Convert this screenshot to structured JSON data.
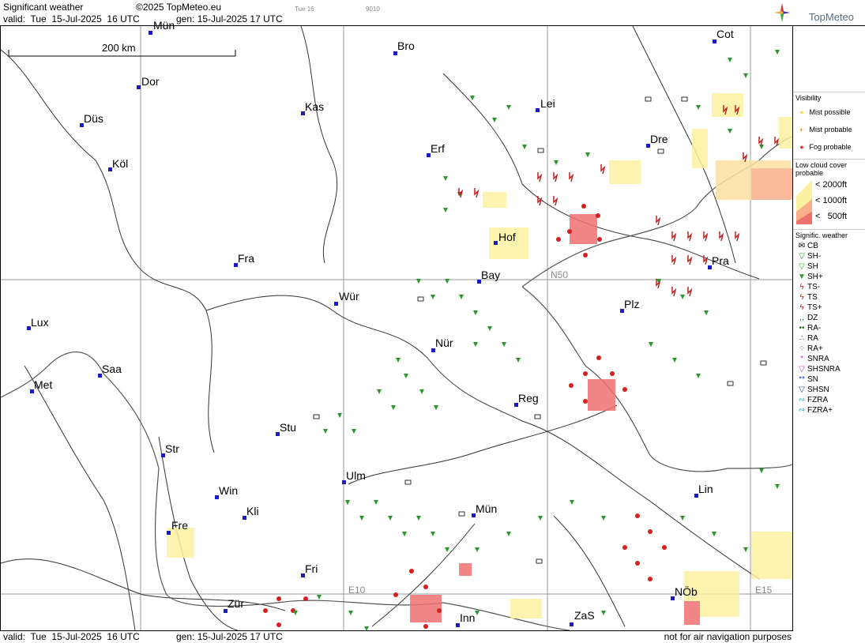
{
  "header": {
    "title": "Significant weather",
    "copyright": "©2025 TopMeteo.eu",
    "valid": "valid:  Tue  15-Jul-2025  16 UTC",
    "gen": "gen: 15-Jul-2025 17 UTC",
    "day_tab": "Tue 16",
    "code": "9010",
    "logo": "TopMeteo"
  },
  "map": {
    "scale_label": "200 km",
    "grid_labels": [
      "N50",
      "E10",
      "E15"
    ],
    "cities": [
      {
        "name": "Mün",
        "id": "mun-top"
      },
      {
        "name": "Bro"
      },
      {
        "name": "Cot"
      },
      {
        "name": "Dor"
      },
      {
        "name": "Kas"
      },
      {
        "name": "Lei"
      },
      {
        "name": "Düs"
      },
      {
        "name": "Erf"
      },
      {
        "name": "Dre"
      },
      {
        "name": "Köl"
      },
      {
        "name": "Fra"
      },
      {
        "name": "Hof"
      },
      {
        "name": "Pra"
      },
      {
        "name": "Bay"
      },
      {
        "name": "Wür"
      },
      {
        "name": "Plz"
      },
      {
        "name": "Lux"
      },
      {
        "name": "Nür"
      },
      {
        "name": "Saa"
      },
      {
        "name": "Met"
      },
      {
        "name": "Reg"
      },
      {
        "name": "Stu"
      },
      {
        "name": "Str"
      },
      {
        "name": "Ulm"
      },
      {
        "name": "Lin"
      },
      {
        "name": "Win"
      },
      {
        "name": "Mün"
      },
      {
        "name": "Kli"
      },
      {
        "name": "Fre"
      },
      {
        "name": "Fri"
      },
      {
        "name": "NÖb"
      },
      {
        "name": "Zür"
      },
      {
        "name": "Inn"
      },
      {
        "name": "ZaS"
      }
    ]
  },
  "legend": {
    "visibility_title": "Visibility",
    "visibility": [
      {
        "label": "Mist possible",
        "color": "#f5e050"
      },
      {
        "label": "Mist probable",
        "color": "#f59a30"
      },
      {
        "label": "Fog probable",
        "color": "#e03030"
      }
    ],
    "lowcloud_title": "Low cloud cover probable",
    "lowcloud": [
      "< 2000ft",
      "< 1000ft",
      "<   500ft"
    ],
    "signif_title": "Signific. weather",
    "signif": [
      "CB",
      "SH-",
      "SH",
      "SH+",
      "TS-",
      "TS",
      "TS+",
      "DZ",
      "RA-",
      "RA",
      "RA+",
      "SNRA",
      "SHSNRA",
      "SN",
      "SHSN",
      "FZRA",
      "FZRA+"
    ]
  },
  "footer": {
    "valid": "valid:  Tue  15-Jul-2025  16 UTC",
    "gen": "gen: 15-Jul-2025 17 UTC",
    "disclaimer": "not for air navigation purposes"
  }
}
